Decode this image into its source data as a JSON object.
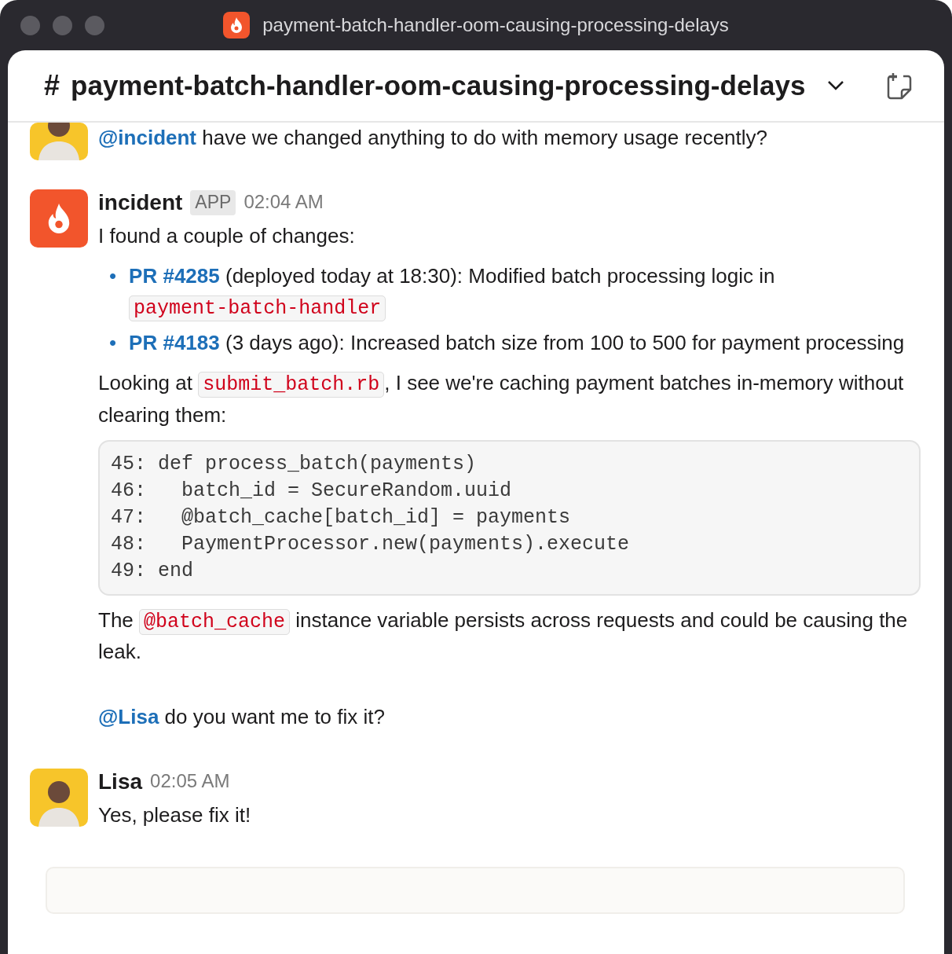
{
  "window": {
    "title": "payment-batch-handler-oom-causing-processing-delays"
  },
  "channel": {
    "prefix": "#",
    "name": "payment-batch-handler-oom-causing-processing-delays"
  },
  "messages": [
    {
      "kind": "user",
      "clipped": true,
      "blocks": [
        {
          "kind": "para",
          "parts": [
            {
              "kind": "link",
              "text": "@incident"
            },
            {
              "kind": "plain",
              "text": " have we changed anything to do with memory usage recently?"
            }
          ]
        }
      ]
    },
    {
      "kind": "app",
      "clipped": false,
      "author": "incident",
      "badge": "APP",
      "time": "02:04 AM",
      "blocks": [
        {
          "kind": "para",
          "parts": [
            {
              "kind": "plain",
              "text": "I found a couple of changes:"
            }
          ]
        },
        {
          "kind": "list",
          "bullet": "•",
          "items": [
            [
              {
                "kind": "link",
                "text": "PR #4285"
              },
              {
                "kind": "plain",
                "text": " (deployed today at 18:30): Modified batch processing logic in "
              },
              {
                "kind": "code",
                "text": "payment-batch-handler"
              }
            ],
            [
              {
                "kind": "link",
                "text": "PR #4183"
              },
              {
                "kind": "plain",
                "text": "  (3 days ago): Increased batch size from 100 to 500 for payment processing"
              }
            ]
          ]
        },
        {
          "kind": "para",
          "parts": [
            {
              "kind": "plain",
              "text": "Looking at "
            },
            {
              "kind": "code",
              "text": "submit_batch.rb"
            },
            {
              "kind": "plain",
              "text": ", I see we're caching payment batches in-memory without clearing them:"
            }
          ]
        },
        {
          "kind": "codeblock",
          "lines": [
            "45: def process_batch(payments)",
            "46:   batch_id = SecureRandom.uuid",
            "47:   @batch_cache[batch_id] = payments",
            "48:   PaymentProcessor.new(payments).execute",
            "49: end"
          ]
        },
        {
          "kind": "para",
          "parts": [
            {
              "kind": "plain",
              "text": "The "
            },
            {
              "kind": "code",
              "text": "@batch_cache"
            },
            {
              "kind": "plain",
              "text": " instance variable persists across requests and could be causing the leak."
            }
          ]
        },
        {
          "kind": "spacer"
        },
        {
          "kind": "para",
          "parts": [
            {
              "kind": "link",
              "text": "@Lisa"
            },
            {
              "kind": "plain",
              "text": " do you want me to fix it?"
            }
          ]
        }
      ]
    },
    {
      "kind": "user",
      "clipped": false,
      "author": "Lisa",
      "time": "02:05 AM",
      "blocks": [
        {
          "kind": "para",
          "parts": [
            {
              "kind": "plain",
              "text": "Yes, please fix it!"
            }
          ]
        }
      ]
    }
  ]
}
